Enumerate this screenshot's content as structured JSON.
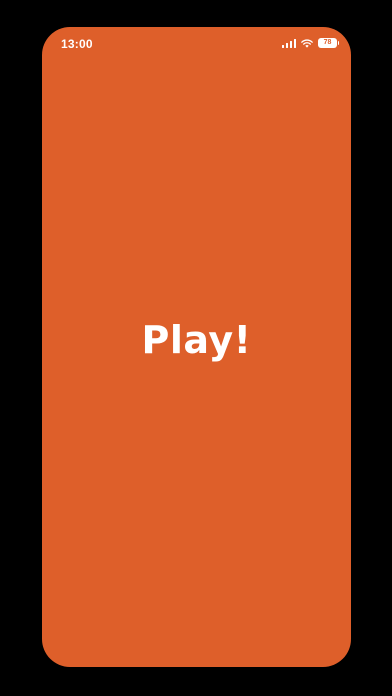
{
  "status_bar": {
    "time": "13:00",
    "battery_level": "78",
    "icons": [
      "signal-icon",
      "wifi-icon",
      "battery-icon"
    ]
  },
  "main": {
    "play_label": "Play!"
  },
  "colors": {
    "background": "#000000",
    "screen": "#DE5F2A",
    "foreground": "#FFFFFF"
  }
}
